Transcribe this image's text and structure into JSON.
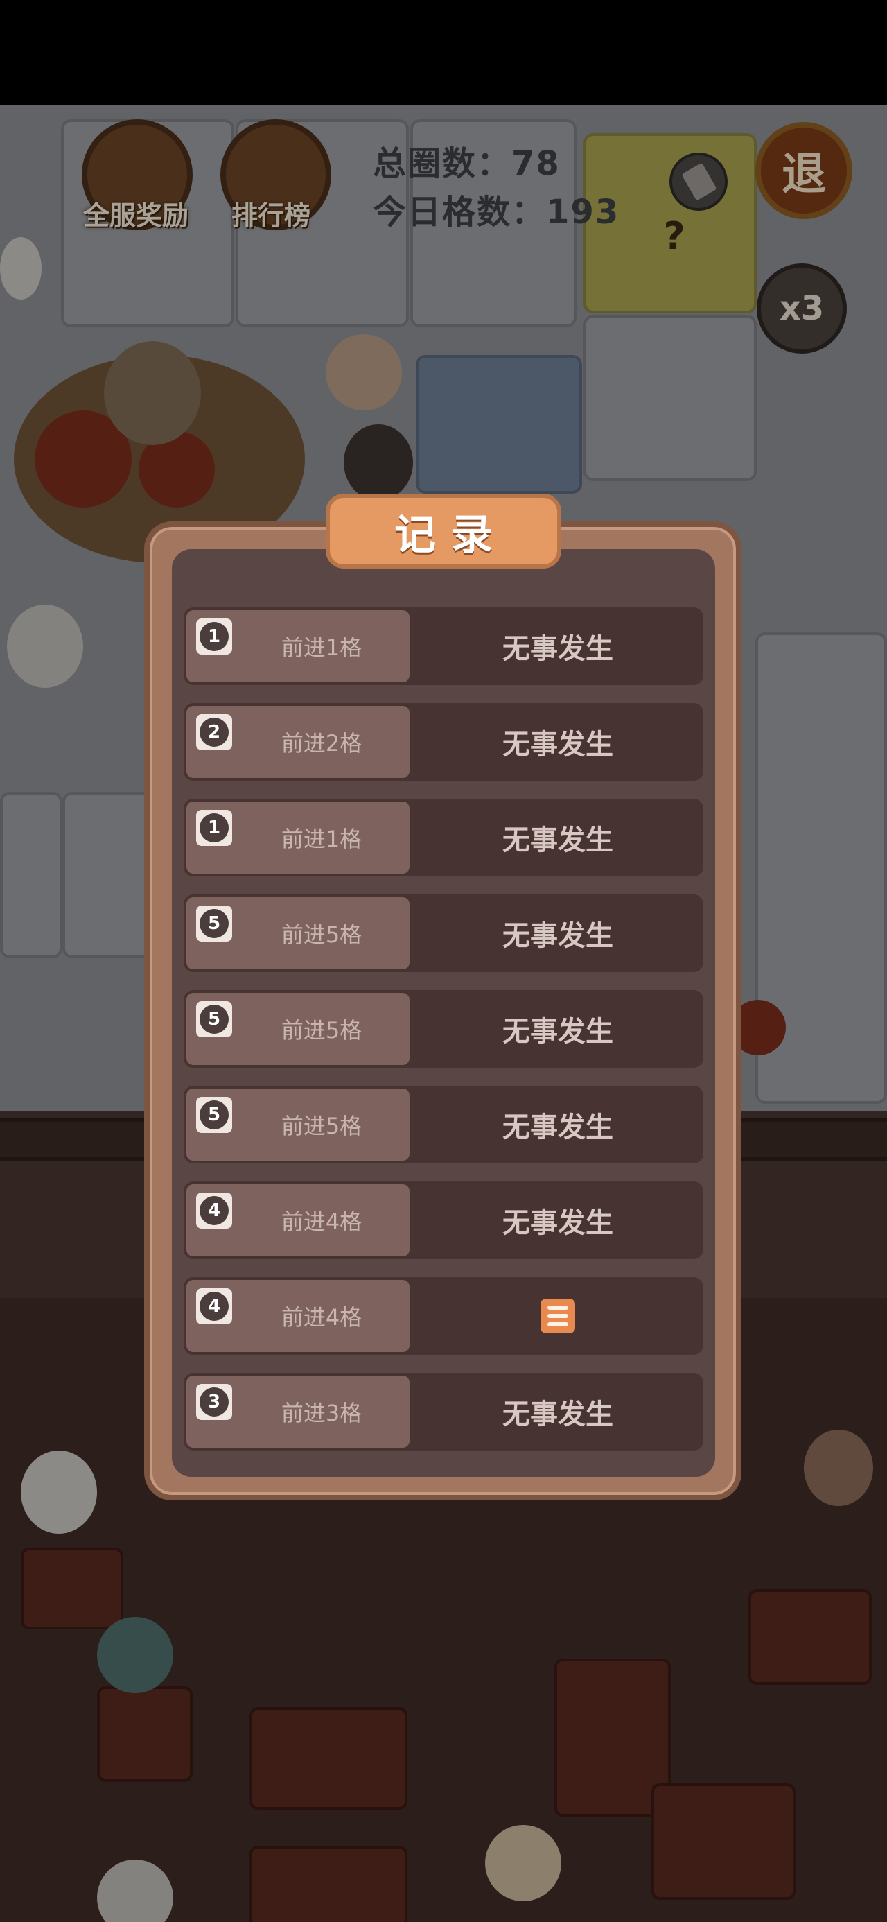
{
  "hud": {
    "server_reward_label": "全服奖励",
    "leaderboard_label": "排行榜",
    "total_laps_label": "总圈数：",
    "total_laps_value": "78",
    "today_steps_label": "今日格数：",
    "today_steps_value": "193",
    "exit_label": "退",
    "multiplier_label": "x3",
    "question_mark": "?"
  },
  "modal": {
    "title": "记录",
    "records": [
      {
        "dice": "1",
        "step": "前进1格",
        "event": "无事发生"
      },
      {
        "dice": "2",
        "step": "前进2格",
        "event": "无事发生"
      },
      {
        "dice": "1",
        "step": "前进1格",
        "event": "无事发生"
      },
      {
        "dice": "5",
        "step": "前进5格",
        "event": "无事发生"
      },
      {
        "dice": "5",
        "step": "前进5格",
        "event": "无事发生"
      },
      {
        "dice": "5",
        "step": "前进5格",
        "event": "无事发生"
      },
      {
        "dice": "4",
        "step": "前进4格",
        "event": "无事发生"
      },
      {
        "dice": "4",
        "step": "前进4格",
        "event": "",
        "event_icon": "tile-icon"
      },
      {
        "dice": "3",
        "step": "前进3格",
        "event": "无事发生"
      }
    ]
  },
  "colors": {
    "title_tab": "#e69a63",
    "modal_frame": "#a2765f",
    "modal_panel": "#5a4645",
    "row_right": "#463332",
    "row_left": "#7e625d"
  }
}
